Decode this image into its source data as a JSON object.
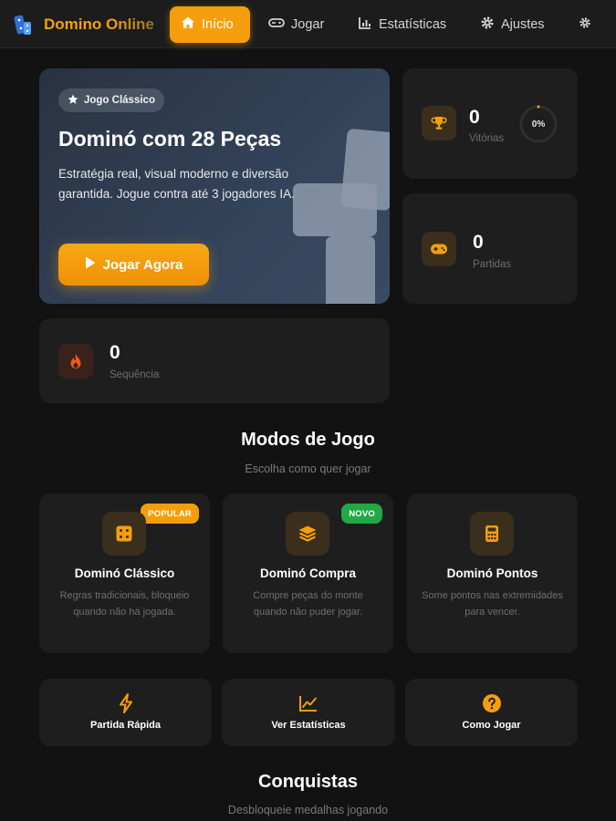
{
  "app": {
    "name": "Domino Online"
  },
  "nav": {
    "items": [
      {
        "label": "Início",
        "icon": "home-icon",
        "active": true
      },
      {
        "label": "Jogar",
        "icon": "gamepad-icon",
        "active": false
      },
      {
        "label": "Estatísticas",
        "icon": "bar-chart-icon",
        "active": false
      },
      {
        "label": "Ajustes",
        "icon": "gear-icon",
        "active": false
      }
    ],
    "extra_icon": "gear-icon"
  },
  "hero": {
    "badge": "Jogo Clássico",
    "title": "Dominó com 28 Peças",
    "description": "Estratégia real, visual moderno e diversão garantida. Jogue contra até 3 jogadores IA.",
    "button": "Jogar Agora"
  },
  "stats": {
    "wins": {
      "value": "0",
      "label": "Vitórias",
      "icon": "trophy-icon",
      "percent_text": "0%",
      "percent": 0
    },
    "games": {
      "value": "0",
      "label": "Partidas",
      "icon": "gamepad-icon"
    },
    "streak": {
      "value": "0",
      "label": "Sequência",
      "icon": "flame-icon"
    }
  },
  "modes_section": {
    "title": "Modos de Jogo",
    "subtitle": "Escolha como quer jogar"
  },
  "modes": [
    {
      "title": "Dominó Clássico",
      "description": "Regras tradicionais, bloqueio quando não há jogada.",
      "badge": "POPULAR",
      "icon": "domino-tile-icon"
    },
    {
      "title": "Dominó Compra",
      "description": "Compre peças do monte quando não puder jogar.",
      "badge": "NOVO",
      "icon": "layers-icon"
    },
    {
      "title": "Dominó Pontos",
      "description": "Some pontos nas extremidades para vencer.",
      "badge": "",
      "icon": "calculator-icon"
    }
  ],
  "actions": [
    {
      "label": "Partida Rápida",
      "icon": "lightning-icon"
    },
    {
      "label": "Ver Estatísticas",
      "icon": "line-chart-icon"
    },
    {
      "label": "Como Jogar",
      "icon": "help-icon"
    }
  ],
  "achievements_section": {
    "title": "Conquistas",
    "subtitle": "Desbloqueie medalhas jogando"
  },
  "colors": {
    "accent": "#f59e0b",
    "background": "#121212",
    "card": "#1e1e1e",
    "badge_popular": "#f59e0b",
    "badge_new": "#22a845"
  }
}
